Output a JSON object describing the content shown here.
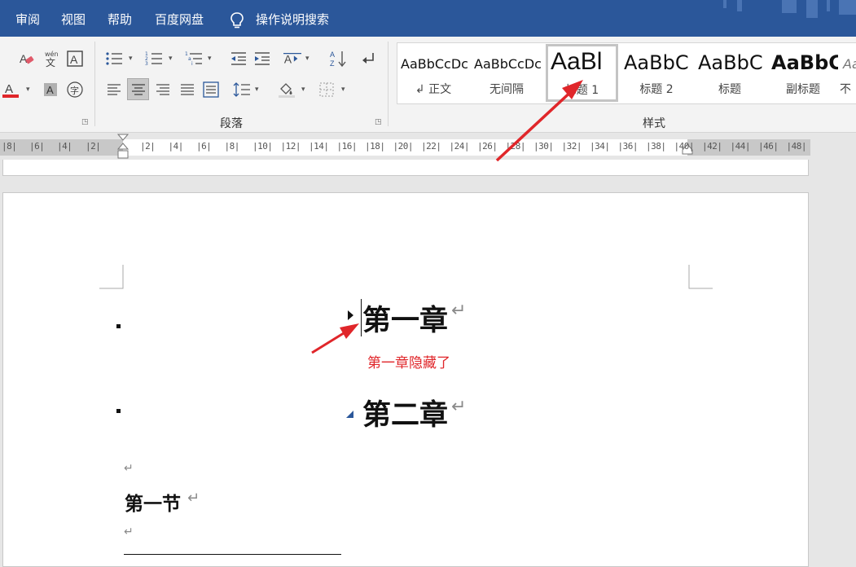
{
  "menu": {
    "items": [
      "审阅",
      "视图",
      "帮助",
      "百度网盘"
    ],
    "search_label": "操作说明搜索"
  },
  "ribbon": {
    "paragraph_group_label": "段落",
    "styles_group_label": "样式",
    "font_color": "#e0262a",
    "icons": [
      "clear-format-icon",
      "pinyin-guide-icon",
      "character-border-icon",
      "font-color-icon",
      "character-shading-icon",
      "enclose-character-icon",
      "bullets-icon",
      "numbering-icon",
      "multilevel-list-icon",
      "decrease-indent-icon",
      "increase-indent-icon",
      "asian-layout-icon",
      "sort-icon",
      "show-marks-icon",
      "align-left-icon",
      "align-center-icon",
      "align-right-icon",
      "justify-icon",
      "distributed-icon",
      "line-spacing-icon",
      "shading-icon",
      "borders-icon"
    ]
  },
  "styles": [
    {
      "preview": "AaBbCcDc",
      "name": "↲ 正文"
    },
    {
      "preview": "AaBbCcDc",
      "name": "无间隔"
    },
    {
      "preview": "AaBl",
      "name": "标题 1",
      "selected": true
    },
    {
      "preview": "AaBbC",
      "name": "标题 2"
    },
    {
      "preview": "AaBbC",
      "name": "标题"
    },
    {
      "preview": "AaBbC",
      "name": "副标题"
    },
    {
      "preview": "Aa",
      "name": "不"
    }
  ],
  "ruler": {
    "left_numbers": [
      "8",
      "6",
      "4",
      "2"
    ],
    "right_numbers": [
      "2",
      "4",
      "6",
      "8",
      "10",
      "12",
      "14",
      "16",
      "18",
      "20",
      "22",
      "24",
      "26",
      "28",
      "30",
      "32",
      "34",
      "36",
      "38",
      "40",
      "42",
      "44",
      "46",
      "48"
    ]
  },
  "document": {
    "chapter1": "第一章",
    "chapter2": "第二章",
    "section1": "第一节",
    "paragraph_mark": "↵",
    "annotation": "第一章隐藏了",
    "annotation_color": "#e0262a"
  }
}
